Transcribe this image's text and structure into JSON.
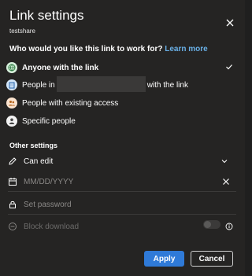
{
  "dialog": {
    "title": "Link settings",
    "subtitle": "testshare",
    "close_icon": "close-icon"
  },
  "audience": {
    "question": "Who would you like this link to work for?",
    "learn_more": "Learn more",
    "options": [
      {
        "label": "Anyone with the link",
        "icon": "globe-icon",
        "selected": true,
        "color": "#9bd0a6"
      },
      {
        "label_prefix": "People in",
        "label_suffix": "with the link",
        "icon": "building-icon",
        "selected": false,
        "color": "#8fc4f0"
      },
      {
        "label": "People with existing access",
        "icon": "people-icon",
        "selected": false,
        "color": "#f1b98a"
      },
      {
        "label": "Specific people",
        "icon": "person-icon",
        "selected": false,
        "color": "#ffffff"
      }
    ]
  },
  "other_settings": {
    "label": "Other settings",
    "permission": {
      "value": "Can edit",
      "icon": "pencil-icon"
    },
    "expiry": {
      "placeholder": "MM/DD/YYYY",
      "icon": "calendar-icon"
    },
    "password": {
      "placeholder": "Set password",
      "icon": "lock-icon"
    },
    "block_download": {
      "label": "Block download",
      "icon": "block-icon",
      "enabled": false
    }
  },
  "buttons": {
    "apply": "Apply",
    "cancel": "Cancel"
  },
  "colors": {
    "accent": "#2f7ad8",
    "link": "#69afe5",
    "background": "#252423"
  }
}
